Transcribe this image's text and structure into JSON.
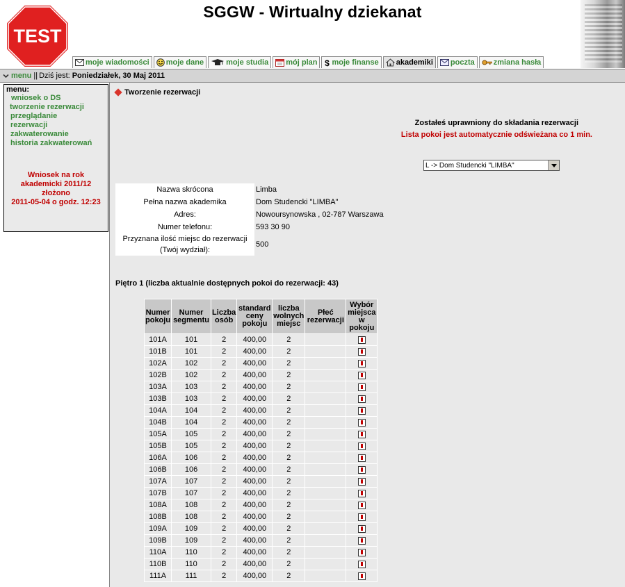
{
  "header": {
    "logo_text": "TEST",
    "title": "SGGW - Wirtualny dziekanat",
    "tabs": [
      {
        "label": "moje wiadomości",
        "icon": "envelope-icon"
      },
      {
        "label": "moje dane",
        "icon": "smiley-icon"
      },
      {
        "label": "moje studia",
        "icon": "graduation-cap-icon"
      },
      {
        "label": "mój plan",
        "icon": "calendar-icon"
      },
      {
        "label": "moje finanse",
        "icon": "dollar-icon"
      },
      {
        "label": "akademiki",
        "icon": "house-icon",
        "active": true
      },
      {
        "label": "poczta",
        "icon": "envelope-icon"
      },
      {
        "label": "zmiana hasła",
        "icon": "key-icon"
      }
    ]
  },
  "navbar": {
    "menu_label": "menu",
    "separator": "||",
    "date_prefix": "Dziś jest:",
    "date": "Poniedziałek, 30 Maj 2011"
  },
  "sidebar": {
    "title": "menu:",
    "items": [
      "wniosek o DS",
      "tworzenie rezerwacji",
      "przeglądanie rezerwacji",
      "zakwaterowanie",
      "historia zakwaterowań"
    ],
    "notice_lines": [
      "Wniosek na rok",
      "akademicki 2011/12",
      "złożono",
      "2011-05-04 o godz. 12:23"
    ]
  },
  "main": {
    "section_title": "Tworzenie rezerwacji",
    "authorized": "Zostałeś uprawniony do składania rezerwacji",
    "autorefresh": "Lista pokoi jest automatycznie odświeżana co 1 min.",
    "dormitory_select": "L -> Dom Studencki \"LIMBA\"",
    "info": {
      "short_name_label": "Nazwa skrócona",
      "short_name": "Limba",
      "full_name_label": "Pełna nazwa akademika",
      "full_name": "Dom Studencki \"LIMBA\"",
      "address_label": "Adres:",
      "address": "Nowoursynowska , 02-787 Warszawa",
      "phone_label": "Numer telefonu:",
      "phone": "593 30 90",
      "places_label_1": "Przyznana ilość miejsc do rezerwacji",
      "places_label_2": "(Twój wydział):",
      "places": "500"
    },
    "floor_heading": "Piętro 1 (liczba aktualnie dostępnych pokoi do rezerwacji: 43)",
    "table": {
      "headers": [
        "Numer pokoju",
        "Numer segmentu",
        "Liczba osób",
        "standard ceny pokoju",
        "liczba wolnych miejsc",
        "Płeć rezerwacji",
        "Wybór miejsca w pokoju"
      ],
      "rows": [
        [
          "101A",
          "101",
          "2",
          "400,00",
          "2",
          ""
        ],
        [
          "101B",
          "101",
          "2",
          "400,00",
          "2",
          ""
        ],
        [
          "102A",
          "102",
          "2",
          "400,00",
          "2",
          ""
        ],
        [
          "102B",
          "102",
          "2",
          "400,00",
          "2",
          ""
        ],
        [
          "103A",
          "103",
          "2",
          "400,00",
          "2",
          ""
        ],
        [
          "103B",
          "103",
          "2",
          "400,00",
          "2",
          ""
        ],
        [
          "104A",
          "104",
          "2",
          "400,00",
          "2",
          ""
        ],
        [
          "104B",
          "104",
          "2",
          "400,00",
          "2",
          ""
        ],
        [
          "105A",
          "105",
          "2",
          "400,00",
          "2",
          ""
        ],
        [
          "105B",
          "105",
          "2",
          "400,00",
          "2",
          ""
        ],
        [
          "106A",
          "106",
          "2",
          "400,00",
          "2",
          ""
        ],
        [
          "106B",
          "106",
          "2",
          "400,00",
          "2",
          ""
        ],
        [
          "107A",
          "107",
          "2",
          "400,00",
          "2",
          ""
        ],
        [
          "107B",
          "107",
          "2",
          "400,00",
          "2",
          ""
        ],
        [
          "108A",
          "108",
          "2",
          "400,00",
          "2",
          ""
        ],
        [
          "108B",
          "108",
          "2",
          "400,00",
          "2",
          ""
        ],
        [
          "109A",
          "109",
          "2",
          "400,00",
          "2",
          ""
        ],
        [
          "109B",
          "109",
          "2",
          "400,00",
          "2",
          ""
        ],
        [
          "110A",
          "110",
          "2",
          "400,00",
          "2",
          ""
        ],
        [
          "110B",
          "110",
          "2",
          "400,00",
          "2",
          ""
        ],
        [
          "111A",
          "111",
          "2",
          "400,00",
          "2",
          ""
        ]
      ]
    }
  }
}
